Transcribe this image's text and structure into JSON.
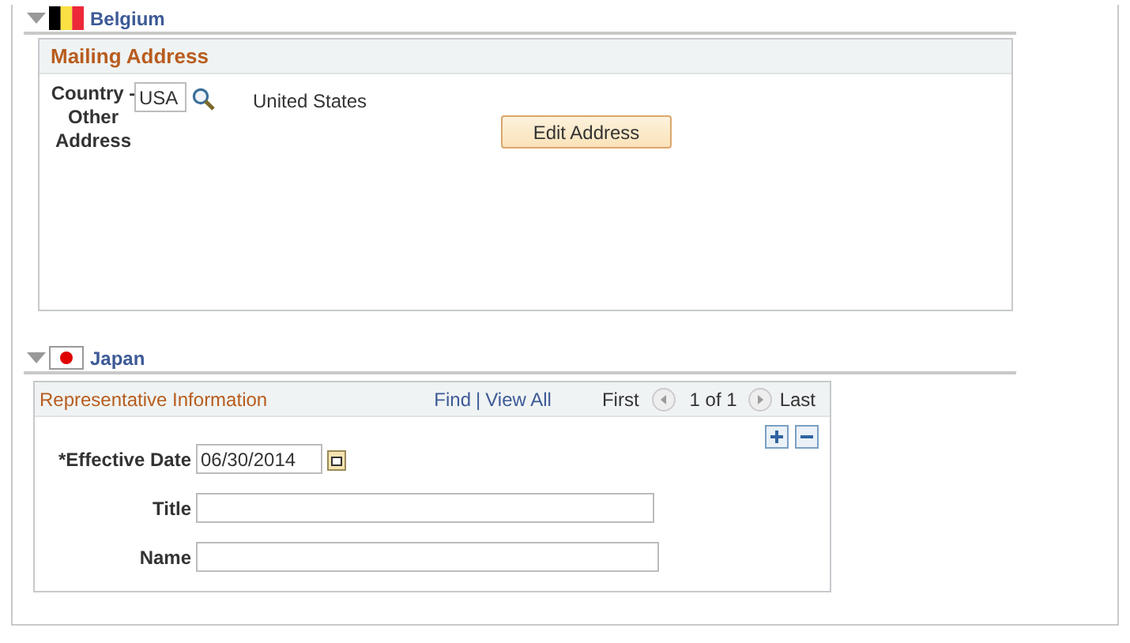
{
  "sections": [
    {
      "title": "Belgium",
      "expanded": true,
      "kind": "address",
      "box_title": "Mailing Address",
      "country_label": "Country - Other Address",
      "country_code": "USA",
      "country_name": "United States",
      "button": "Edit Address"
    },
    {
      "title": "Japan",
      "expanded": true,
      "kind": "representative",
      "box_title": "Representative Information",
      "nav": {
        "find": "Find",
        "separator": "|",
        "view_all": "View All",
        "first": "First",
        "count": "1 of 1",
        "last": "Last"
      },
      "fields": [
        {
          "label": "*Effective Date",
          "value": "06/30/2014",
          "kind": "date"
        },
        {
          "label": "Title",
          "kind": "text"
        },
        {
          "label": "Name",
          "kind": "text"
        }
      ]
    }
  ]
}
